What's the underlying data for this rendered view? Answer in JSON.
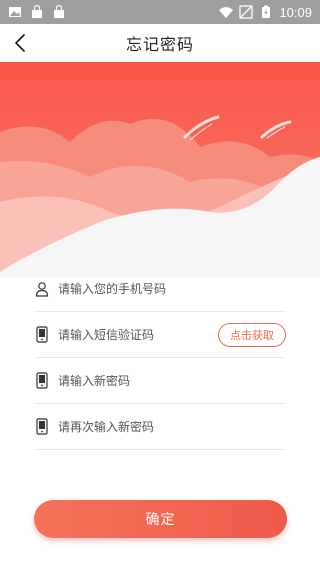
{
  "status_bar": {
    "time": "10:09"
  },
  "header": {
    "title": "忘记密码"
  },
  "form": {
    "phone_placeholder": "请输入您的手机号码",
    "sms_placeholder": "请输入短信验证码",
    "get_code_label": "点击获取",
    "new_password_placeholder": "请输入新密码",
    "confirm_password_placeholder": "请再次输入新密码"
  },
  "actions": {
    "confirm_label": "确定"
  },
  "colors": {
    "accent": "#f05a4a",
    "banner_top": "#f9574a"
  }
}
